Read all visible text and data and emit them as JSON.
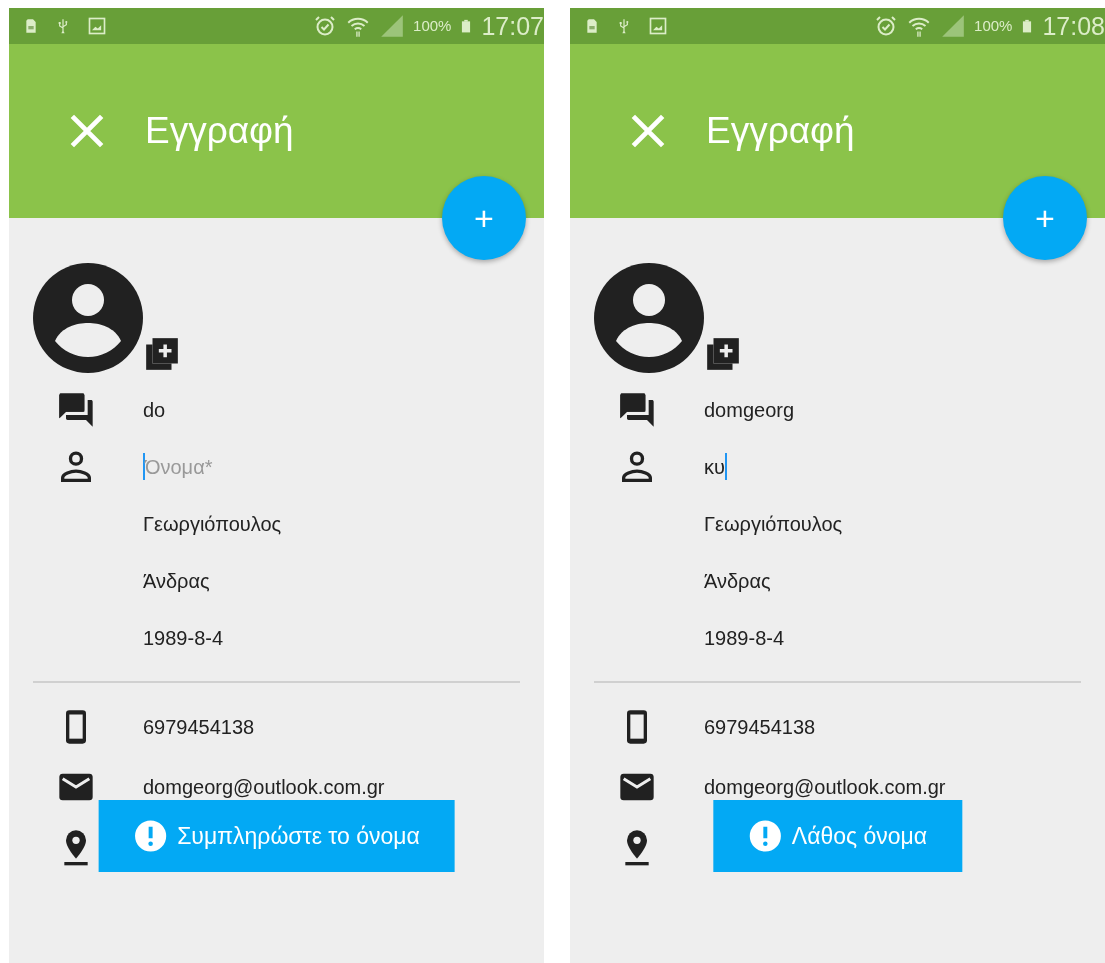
{
  "screens": [
    {
      "status_bar": {
        "battery_text": "100%",
        "time": "17:07"
      },
      "app_bar": {
        "title": "Εγγραφή"
      },
      "fab": {
        "label": "+"
      },
      "personal_fields": [
        {
          "kind": "nickname",
          "value": "do",
          "focused": false
        },
        {
          "kind": "name",
          "placeholder": "Όνομα*",
          "focused": true
        },
        {
          "kind": "surname",
          "value": "Γεωργιόπουλος",
          "focused": false
        },
        {
          "kind": "gender",
          "value": "Άνδρας",
          "focused": false
        },
        {
          "kind": "birthdate",
          "value": "1989-8-4",
          "focused": false
        }
      ],
      "contact_fields": [
        {
          "kind": "phone",
          "value": "6979454138",
          "focused": false
        },
        {
          "kind": "email",
          "value": "domgeorg@outlook.com.gr",
          "focused": false
        },
        {
          "kind": "address"
        }
      ],
      "toast": {
        "message": "Συμπληρώστε το όνομα"
      }
    },
    {
      "status_bar": {
        "battery_text": "100%",
        "time": "17:08"
      },
      "app_bar": {
        "title": "Εγγραφή"
      },
      "fab": {
        "label": "+"
      },
      "personal_fields": [
        {
          "kind": "nickname",
          "value": "domgeorg",
          "focused": false
        },
        {
          "kind": "name",
          "value": "κυ",
          "focused": true
        },
        {
          "kind": "surname",
          "value": "Γεωργιόπουλος",
          "focused": false
        },
        {
          "kind": "gender",
          "value": "Άνδρας",
          "focused": false
        },
        {
          "kind": "birthdate",
          "value": "1989-8-4",
          "focused": false
        }
      ],
      "contact_fields": [
        {
          "kind": "phone",
          "value": "6979454138",
          "focused": false
        },
        {
          "kind": "email",
          "value": "domgeorg@outlook.com.gr",
          "focused": false
        },
        {
          "kind": "address"
        }
      ],
      "toast": {
        "message": "Λάθος όνομα"
      }
    }
  ]
}
